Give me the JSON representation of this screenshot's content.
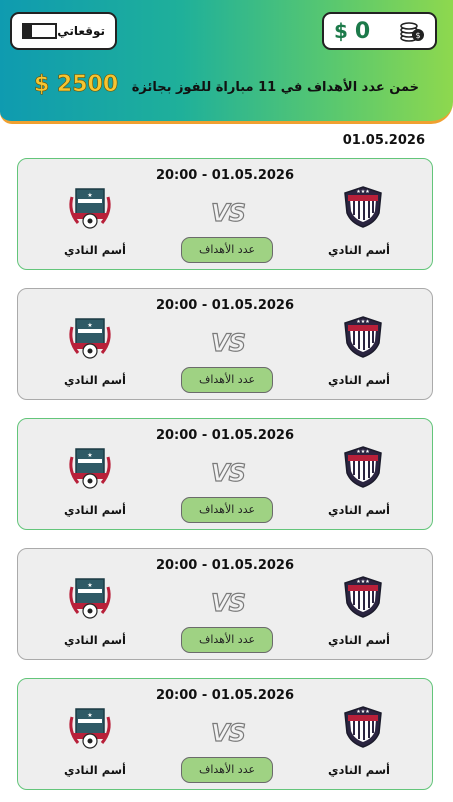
{
  "header": {
    "balance_value": "0",
    "balance_currency": "$",
    "predictions_label": "توقعاتي",
    "headline_text": "خمن عدد الأهداف في",
    "headline_count": "11",
    "headline_mid": "مباراة  للفوز بجائزة",
    "prize_amount": "2500",
    "prize_currency": "$"
  },
  "date_label": "01.05.2026",
  "matches": [
    {
      "time": "20:00  -  01.05.2026",
      "vs": "VS",
      "home": "أسم النادي",
      "away": "أسم النادي",
      "button": "عدد الأهداف"
    },
    {
      "time": "20:00  -  01.05.2026",
      "vs": "VS",
      "home": "أسم النادي",
      "away": "أسم النادي",
      "button": "عدد الأهداف"
    },
    {
      "time": "20:00  -  01.05.2026",
      "vs": "VS",
      "home": "أسم النادي",
      "away": "أسم النادي",
      "button": "عدد الأهداف"
    },
    {
      "time": "20:00  -  01.05.2026",
      "vs": "VS",
      "home": "أسم النادي",
      "away": "أسم النادي",
      "button": "عدد الأهداف"
    },
    {
      "time": "20:00  -  01.05.2026",
      "vs": "VS",
      "home": "أسم النادي",
      "away": "أسم النادي",
      "button": "عدد الأهداف"
    }
  ],
  "colors": {
    "accent_green": "#63c57a",
    "button_green": "#9fd283",
    "prize_gold": "#f5c531",
    "header_gradient": [
      "#0f9bb0",
      "#8ed84e"
    ]
  },
  "icons": {
    "balance": "coins-stack-icon",
    "home_crest": "shield-crest-icon",
    "away_crest": "wreath-crest-icon"
  }
}
